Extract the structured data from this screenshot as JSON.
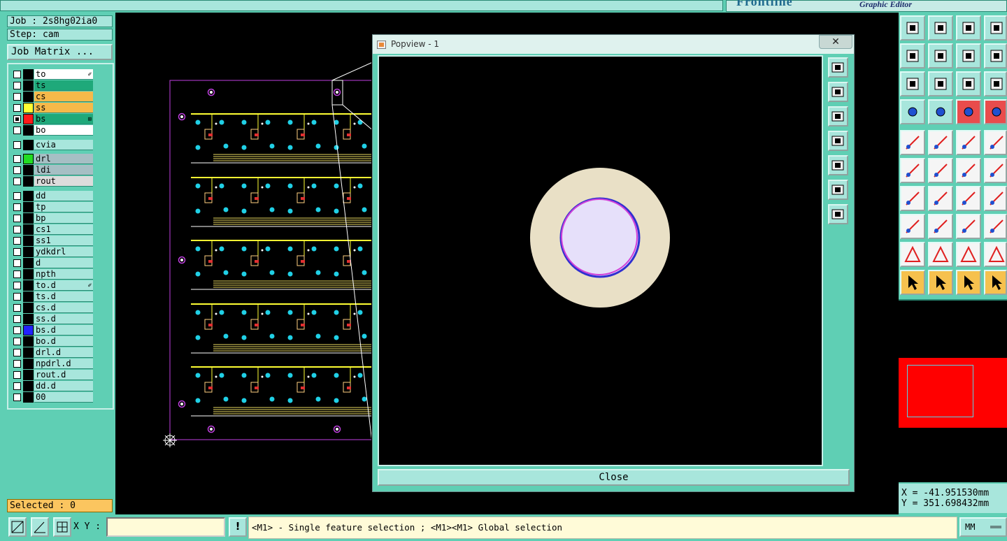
{
  "app": {
    "brand_logo": "Frontline",
    "brand_subtitle": "Graphic Editor"
  },
  "job": {
    "job_line": "Job : 2s8hg02ia0",
    "step_line": "Step: cam",
    "job_matrix_label": "Job Matrix ..."
  },
  "layers": [
    {
      "name": "to",
      "bg": "#ffffff",
      "color": "#000000",
      "mark": "✐"
    },
    {
      "name": "ts",
      "bg": "#1fa97a",
      "color": "#000000"
    },
    {
      "name": "cs",
      "bg": "#f6b94a",
      "color": "#000000"
    },
    {
      "name": "ss",
      "bg": "#f6b94a",
      "color": "#ffff33"
    },
    {
      "name": "bs",
      "bg": "#1fa97a",
      "color": "#ff1a1a",
      "checked": true,
      "mark": "⊞"
    },
    {
      "name": "bo",
      "bg": "#ffffff",
      "color": "#000000"
    },
    {
      "name": "cvia",
      "bg": "#a8e6dc",
      "color": "#000000"
    },
    {
      "name": "drl",
      "bg": "#a6bfc4",
      "color": "#22dd22"
    },
    {
      "name": "ldi",
      "bg": "#a6bfc4",
      "color": "#000000"
    },
    {
      "name": "rout",
      "bg": "#dcdcdc",
      "color": "#000000"
    },
    {
      "name": "dd",
      "bg": "#a8e6dc",
      "color": "#000000"
    },
    {
      "name": "tp",
      "bg": "#a8e6dc",
      "color": "#000000"
    },
    {
      "name": "bp",
      "bg": "#a8e6dc",
      "color": "#000000"
    },
    {
      "name": "cs1",
      "bg": "#a8e6dc",
      "color": "#000000"
    },
    {
      "name": "ss1",
      "bg": "#a8e6dc",
      "color": "#000000"
    },
    {
      "name": "ydkdrl",
      "bg": "#a8e6dc",
      "color": "#000000"
    },
    {
      "name": "d",
      "bg": "#a8e6dc",
      "color": "#000000"
    },
    {
      "name": "npth",
      "bg": "#a8e6dc",
      "color": "#000000"
    },
    {
      "name": "to.d",
      "bg": "#a8e6dc",
      "color": "#000000",
      "mark": "✐"
    },
    {
      "name": "ts.d",
      "bg": "#a8e6dc",
      "color": "#000000"
    },
    {
      "name": "cs.d",
      "bg": "#a8e6dc",
      "color": "#000000"
    },
    {
      "name": "ss.d",
      "bg": "#a8e6dc",
      "color": "#000000"
    },
    {
      "name": "bs.d",
      "bg": "#a8e6dc",
      "color": "#2222ff"
    },
    {
      "name": "bo.d",
      "bg": "#a8e6dc",
      "color": "#000000"
    },
    {
      "name": "drl.d",
      "bg": "#a8e6dc",
      "color": "#000000"
    },
    {
      "name": "npdrl.d",
      "bg": "#a8e6dc",
      "color": "#000000"
    },
    {
      "name": "rout.d",
      "bg": "#a8e6dc",
      "color": "#000000"
    },
    {
      "name": "dd.d",
      "bg": "#a8e6dc",
      "color": "#000000"
    },
    {
      "name": "00",
      "bg": "#a8e6dc",
      "color": "#000000"
    }
  ],
  "selected_label": "Selected : 0",
  "popview": {
    "title": "Popview - 1",
    "close_x": "✕",
    "close_label": "Close",
    "side_buttons": [
      "zoom-window",
      "pan-up",
      "pan-down",
      "pan-left",
      "pan-right",
      "zoom-in",
      "zoom-out"
    ]
  },
  "toolbar_icons": [
    [
      "home-icon",
      "export-icon",
      "house-icon",
      "grid-corner-icon"
    ],
    [
      "arrow-left-icon",
      "arrow-right-icon",
      "rotate-icon",
      "snap-icon"
    ],
    [
      "zoom-fit-icon",
      "zoom-center-icon",
      "scale-1-2-icon",
      "help-icon"
    ],
    [
      "measure-tool-icon",
      "grid-icon",
      "net-highlight-icon",
      "net-compare-icon"
    ],
    [
      "pad-add-icon",
      "shape-add-icon",
      "ruler-icon",
      "dot-icon"
    ],
    [
      "node-connect-icon",
      "cross-icon",
      "arrow-pad-icon",
      "pad-arrow-icon"
    ],
    [
      "angle-icon",
      "line-icon",
      "arc-icon",
      "flip-icon"
    ],
    [
      "pad-red-icon",
      "minus-icon",
      "box-icon",
      "copy-icon"
    ],
    [
      "triangle-icon",
      "arrow-up-triangle-icon",
      "arch-icon",
      "arch-cross-icon"
    ],
    [
      "select-pointer-icon",
      "select-pointer-2-icon",
      "select-pointer-3-icon",
      "route-icon"
    ]
  ],
  "coords": {
    "x": "X = -41.951530mm",
    "y": "Y = 351.698432mm"
  },
  "bottom": {
    "xy_label": "X Y :",
    "xy_value": "",
    "warn": "!",
    "message": "<M1> - Single feature selection ; <M1><M1> Global selection",
    "units": "MM"
  },
  "colors": {
    "panel": "#5fcfb4",
    "field": "#a8e6dc",
    "pad_outer": "#e9e0c6",
    "pad_inner": "#e6e0fa",
    "pad_ring": "#c040e0",
    "yellow": "#ffff33",
    "cyan": "#20d0e6",
    "magenta": "#c040e0"
  }
}
